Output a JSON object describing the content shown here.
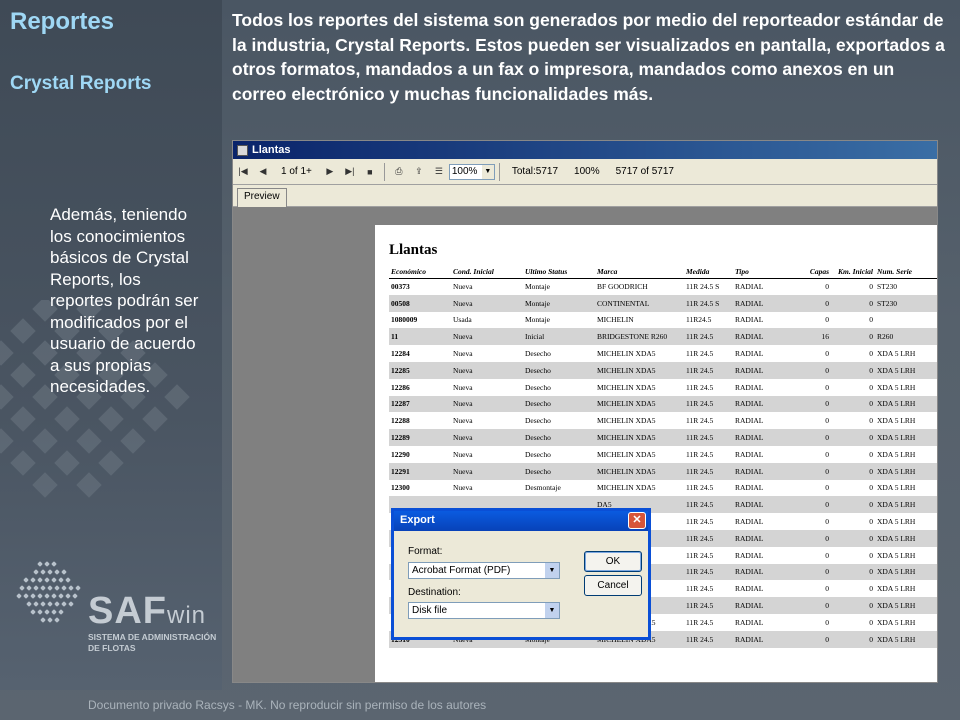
{
  "slide": {
    "title": "Reportes",
    "subtitle": "Crystal Reports",
    "intro": "Todos los reportes del sistema son generados por medio del reporteador estándar de la industria, Crystal Reports.  Estos pueden ser visualizados en pantalla, exportados a otros formatos, mandados a un fax o impresora, mandados como anexos en un correo electrónico y muchas funcionalidades más.",
    "side_text": "Además, teniendo los conocimientos básicos de Crystal Reports, los reportes podrán ser modificados por el usuario de acuerdo a sus propias necesidades.",
    "footer": "Documento privado Racsys - MK. No reproducir sin permiso de los autores"
  },
  "logo": {
    "main": "SAF",
    "suffix": "win",
    "line1": "SISTEMA DE ADMINISTRACIÓN",
    "line2": "DE FLOTAS"
  },
  "window": {
    "title": "Llantas",
    "page_indicator": "1 of 1+",
    "zoom": "100%",
    "total": "Total:5717",
    "percent": "100%",
    "count": "5717 of 5717",
    "tab": "Preview"
  },
  "report": {
    "title": "Llantas",
    "columns": [
      "Económico",
      "Cond. Inicial",
      "Ultimo Status",
      "Marca",
      "Medida",
      "Tipo",
      "Capas",
      "Km. Inicial",
      "Num. Serie"
    ],
    "rows": [
      [
        "00373",
        "Nueva",
        "Montaje",
        "BF GOODRICH",
        "11R 24.5 S",
        "RADIAL",
        "0",
        "0",
        "ST230"
      ],
      [
        "00508",
        "Nueva",
        "Montaje",
        "CONTINENTAL",
        "11R 24.5 S",
        "RADIAL",
        "0",
        "0",
        "ST230"
      ],
      [
        "1080009",
        "Usada",
        "Montaje",
        "MICHELIN",
        "11R24.5",
        "RADIAL",
        "0",
        "0",
        ""
      ],
      [
        "11",
        "Nueva",
        "Inicial",
        "BRIDGESTONE R260",
        "11R 24.5",
        "RADIAL",
        "16",
        "0",
        "R260"
      ],
      [
        "12284",
        "Nueva",
        "Desecho",
        "MICHELIN XDA5",
        "11R 24.5",
        "RADIAL",
        "0",
        "0",
        "XDA 5 LRH"
      ],
      [
        "12285",
        "Nueva",
        "Desecho",
        "MICHELIN XDA5",
        "11R 24.5",
        "RADIAL",
        "0",
        "0",
        "XDA 5 LRH"
      ],
      [
        "12286",
        "Nueva",
        "Desecho",
        "MICHELIN XDA5",
        "11R 24.5",
        "RADIAL",
        "0",
        "0",
        "XDA 5 LRH"
      ],
      [
        "12287",
        "Nueva",
        "Desecho",
        "MICHELIN XDA5",
        "11R 24.5",
        "RADIAL",
        "0",
        "0",
        "XDA 5 LRH"
      ],
      [
        "12288",
        "Nueva",
        "Desecho",
        "MICHELIN XDA5",
        "11R 24.5",
        "RADIAL",
        "0",
        "0",
        "XDA 5 LRH"
      ],
      [
        "12289",
        "Nueva",
        "Desecho",
        "MICHELIN XDA5",
        "11R 24.5",
        "RADIAL",
        "0",
        "0",
        "XDA 5 LRH"
      ],
      [
        "12290",
        "Nueva",
        "Desecho",
        "MICHELIN XDA5",
        "11R 24.5",
        "RADIAL",
        "0",
        "0",
        "XDA 5 LRH"
      ],
      [
        "12291",
        "Nueva",
        "Desecho",
        "MICHELIN XDA5",
        "11R 24.5",
        "RADIAL",
        "0",
        "0",
        "XDA 5 LRH"
      ],
      [
        "12300",
        "Nueva",
        "Desmontaje",
        "MICHELIN XDA5",
        "11R 24.5",
        "RADIAL",
        "0",
        "0",
        "XDA 5 LRH"
      ],
      [
        "",
        "",
        "",
        "DA5",
        "11R 24.5",
        "RADIAL",
        "0",
        "0",
        "XDA 5 LRH"
      ],
      [
        "",
        "",
        "",
        "DA5",
        "11R 24.5",
        "RADIAL",
        "0",
        "0",
        "XDA 5 LRH"
      ],
      [
        "",
        "",
        "",
        "DA5",
        "11R 24.5",
        "RADIAL",
        "0",
        "0",
        "XDA 5 LRH"
      ],
      [
        "",
        "",
        "",
        "DA5",
        "11R 24.5",
        "RADIAL",
        "0",
        "0",
        "XDA 5 LRH"
      ],
      [
        "",
        "",
        "",
        "DA5",
        "11R 24.5",
        "RADIAL",
        "0",
        "0",
        "XDA 5 LRH"
      ],
      [
        "",
        "",
        "",
        "DA5",
        "11R 24.5",
        "RADIAL",
        "0",
        "0",
        "XDA 5 LRH"
      ],
      [
        "",
        "",
        "",
        "DA5",
        "11R 24.5",
        "RADIAL",
        "0",
        "0",
        "XDA 5 LRH"
      ],
      [
        "12309",
        "Nueva",
        "Montaje",
        "MICHELIN XDA5",
        "11R 24.5",
        "RADIAL",
        "0",
        "0",
        "XDA 5 LRH"
      ],
      [
        "12310",
        "Nueva",
        "Montaje",
        "MICHELIN XDA5",
        "11R 24.5",
        "RADIAL",
        "0",
        "0",
        "XDA 5 LRH"
      ]
    ]
  },
  "export_dialog": {
    "title": "Export",
    "format_label": "Format:",
    "format_value": "Acrobat Format (PDF)",
    "destination_label": "Destination:",
    "destination_value": "Disk file",
    "ok_label": "OK",
    "cancel_label": "Cancel"
  },
  "colors": {
    "title_accent": "#9fd8f5",
    "window_titlebar": "#0a246a",
    "dialog_titlebar": "#0a5be0"
  }
}
